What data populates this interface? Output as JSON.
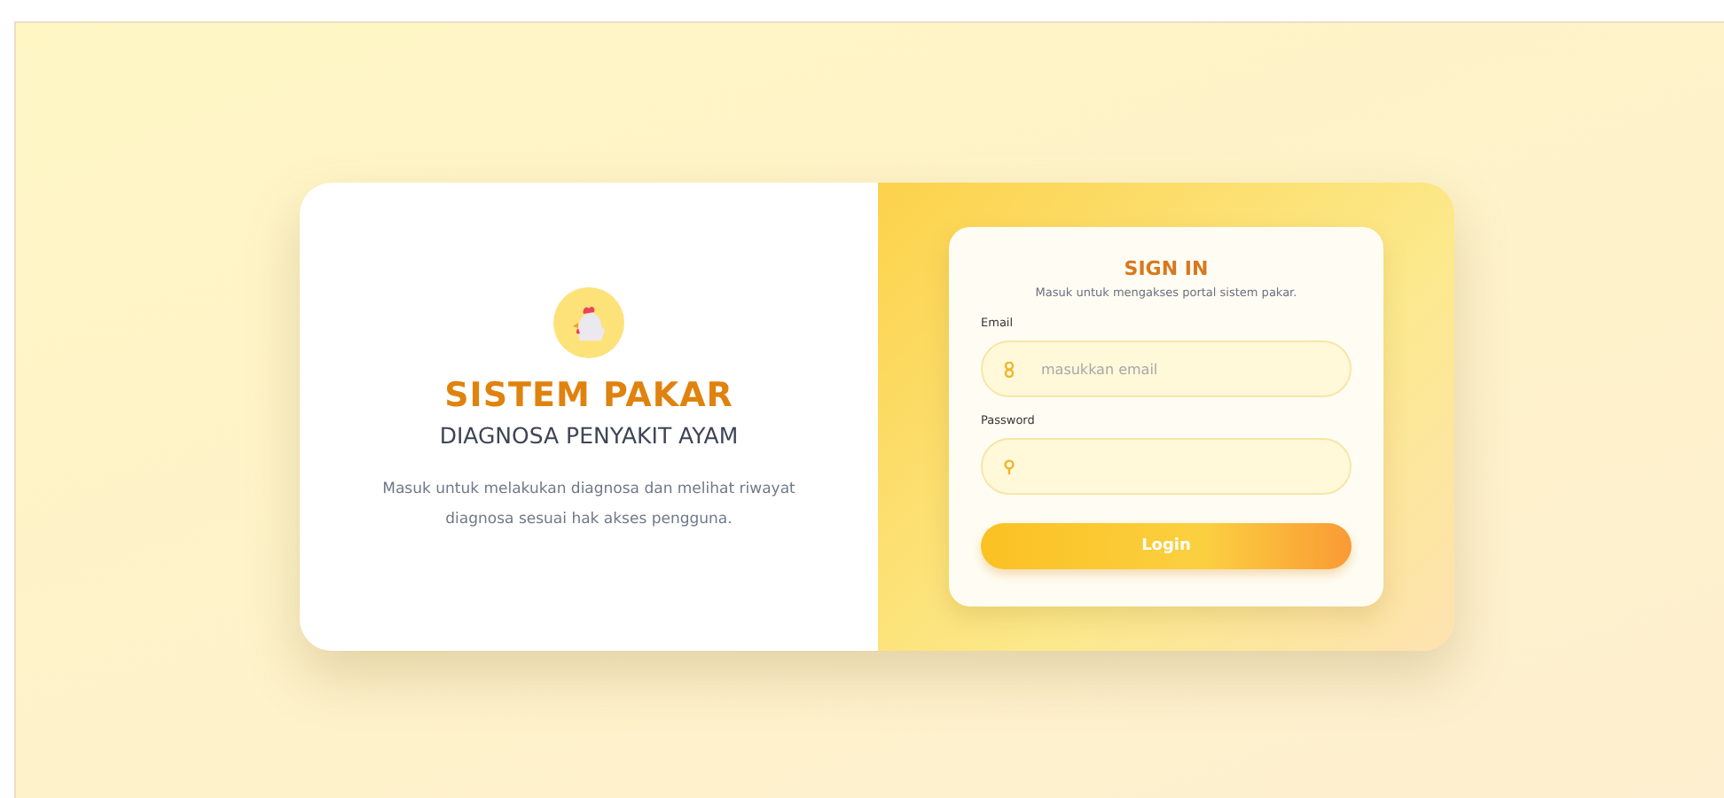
{
  "intro": {
    "title": "SISTEM PAKAR",
    "subtitle": "DIAGNOSA PENYAKIT AYAM",
    "description": "Masuk untuk melakukan diagnosa dan melihat riwayat diagnosa sesuai hak akses pengguna."
  },
  "signin": {
    "title": "SIGN IN",
    "subtitle": "Masuk untuk mengakses portal sistem pakar.",
    "fields": [
      {
        "kind": "email",
        "label": "Email",
        "placeholder": "masukkan email"
      },
      {
        "kind": "password",
        "label": "Password"
      }
    ],
    "button": "Login"
  }
}
